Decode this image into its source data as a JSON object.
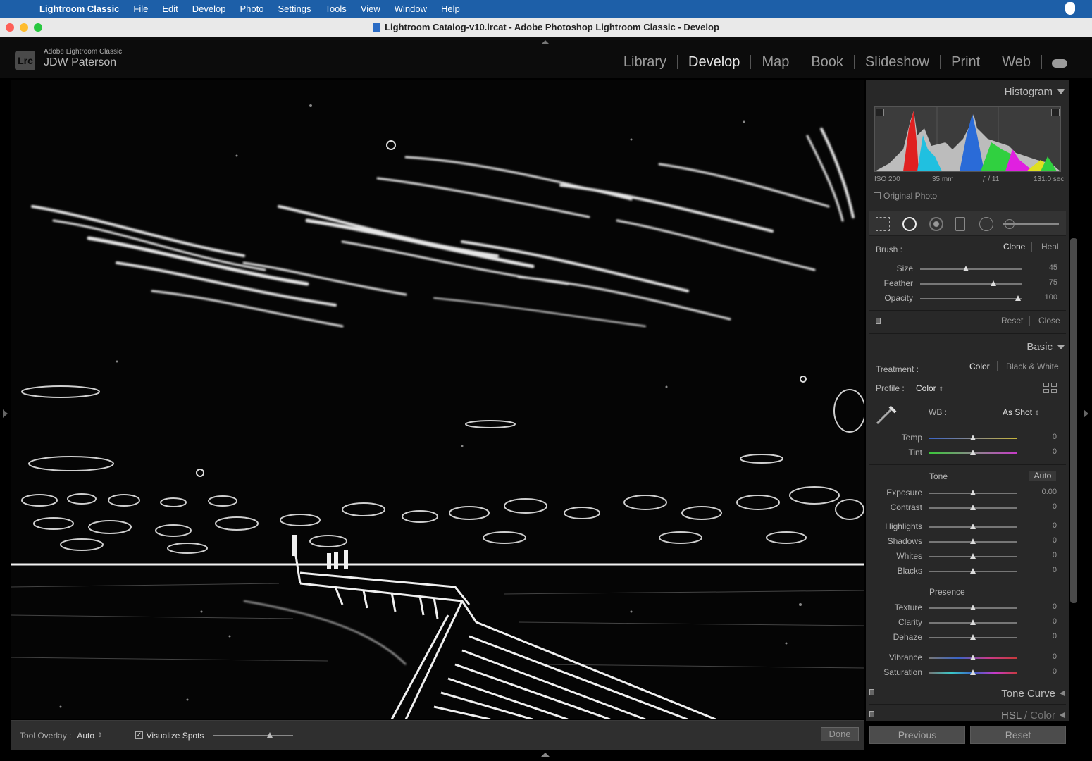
{
  "menubar": {
    "app_name": "Lightroom Classic",
    "items": [
      "File",
      "Edit",
      "Develop",
      "Photo",
      "Settings",
      "Tools",
      "View",
      "Window",
      "Help"
    ]
  },
  "window": {
    "title": "Lightroom Catalog-v10.lrcat - Adobe Photoshop Lightroom Classic - Develop"
  },
  "header": {
    "badge": "Lrc",
    "brand": "Adobe Lightroom Classic",
    "user": "JDW Paterson",
    "modules": [
      "Library",
      "Develop",
      "Map",
      "Book",
      "Slideshow",
      "Print",
      "Web"
    ],
    "active_module": "Develop"
  },
  "histogram": {
    "title": "Histogram",
    "iso": "ISO 200",
    "focal": "35 mm",
    "aperture": "ƒ / 11",
    "shutter": "131.0 sec",
    "original_photo": "Original Photo"
  },
  "brush": {
    "label": "Brush :",
    "mode_clone": "Clone",
    "mode_heal": "Heal",
    "size_label": "Size",
    "size_value": "45",
    "size_frac": 0.45,
    "feather_label": "Feather",
    "feather_value": "75",
    "feather_frac": 0.72,
    "opacity_label": "Opacity",
    "opacity_value": "100",
    "opacity_frac": 0.96,
    "reset": "Reset",
    "close": "Close"
  },
  "basic": {
    "title": "Basic",
    "treatment_label": "Treatment :",
    "treatment_color": "Color",
    "treatment_bw": "Black & White",
    "profile_label": "Profile :",
    "profile_value": "Color",
    "wb_label": "WB :",
    "wb_value": "As Shot",
    "temp_label": "Temp",
    "temp_value": "0",
    "tint_label": "Tint",
    "tint_value": "0",
    "tone_label": "Tone",
    "auto": "Auto",
    "exposure_label": "Exposure",
    "exposure_value": "0.00",
    "contrast_label": "Contrast",
    "contrast_value": "0",
    "highlights_label": "Highlights",
    "highlights_value": "0",
    "shadows_label": "Shadows",
    "shadows_value": "0",
    "whites_label": "Whites",
    "whites_value": "0",
    "blacks_label": "Blacks",
    "blacks_value": "0",
    "presence_label": "Presence",
    "texture_label": "Texture",
    "texture_value": "0",
    "clarity_label": "Clarity",
    "clarity_value": "0",
    "dehaze_label": "Dehaze",
    "dehaze_value": "0",
    "vibrance_label": "Vibrance",
    "vibrance_value": "0",
    "saturation_label": "Saturation",
    "saturation_value": "0"
  },
  "panels": {
    "tone_curve": "Tone Curve",
    "hsl": "HSL",
    "hsl_color": "/ Color"
  },
  "toolbar": {
    "overlay_label": "Tool Overlay :",
    "overlay_value": "Auto",
    "visualize_label": "Visualize Spots",
    "visualize_checked": true,
    "visualize_level": 0.7,
    "done": "Done"
  },
  "footer": {
    "previous": "Previous",
    "reset": "Reset"
  }
}
